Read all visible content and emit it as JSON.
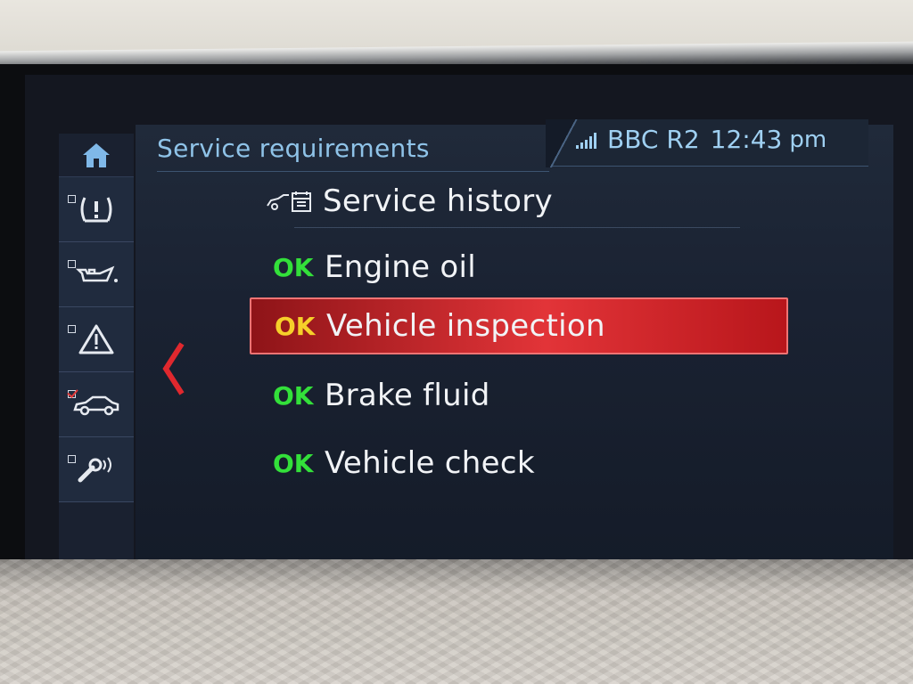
{
  "header": {
    "title": "Service requirements",
    "radio_station": "BBC R2",
    "time": "12:43",
    "ampm": "pm"
  },
  "rail": {
    "items": [
      {
        "icon": "tire-pressure-warning-icon",
        "checked": false
      },
      {
        "icon": "oil-can-icon",
        "checked": false
      },
      {
        "icon": "warning-triangle-icon",
        "checked": false
      },
      {
        "icon": "car-icon",
        "checked": true
      },
      {
        "icon": "wrench-service-icon",
        "checked": false
      }
    ]
  },
  "menu": {
    "history_label": "Service history",
    "items": [
      {
        "status": "OK",
        "label": "Engine oil",
        "selected": false
      },
      {
        "status": "OK",
        "label": "Vehicle inspection",
        "selected": true
      },
      {
        "status": "OK",
        "label": "Brake fluid",
        "selected": false
      },
      {
        "status": "OK",
        "label": "Vehicle check",
        "selected": false
      }
    ]
  },
  "colors": {
    "ok_green": "#33e03a",
    "ok_selected_yellow": "#f6d02a",
    "selection_red": "#e23438",
    "header_blue": "#8fc3e8",
    "back_arrow_red": "#e0282e"
  }
}
